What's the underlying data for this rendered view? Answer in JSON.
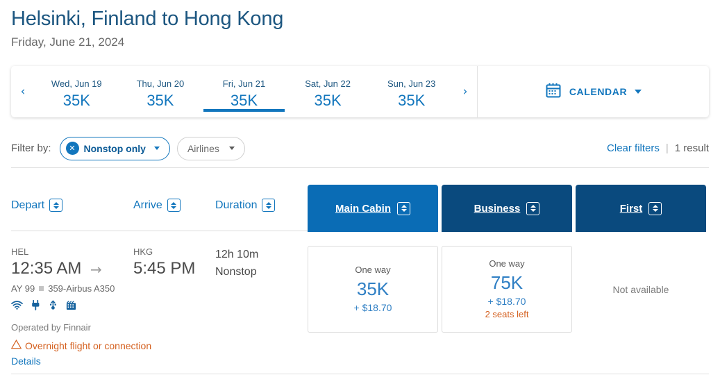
{
  "header": {
    "title": "Helsinki, Finland to Hong Kong",
    "subtitle": "Friday, June 21, 2024"
  },
  "date_strip": {
    "prev_icon": "chevron-left-icon",
    "next_icon": "chevron-right-icon",
    "prev_glyph": "‹",
    "next_glyph": "›",
    "tabs": [
      {
        "label": "Wed, Jun 19",
        "price": "35K",
        "active": false
      },
      {
        "label": "Thu, Jun 20",
        "price": "35K",
        "active": false
      },
      {
        "label": "Fri, Jun 21",
        "price": "35K",
        "active": true
      },
      {
        "label": "Sat, Jun 22",
        "price": "35K",
        "active": false
      },
      {
        "label": "Sun, Jun 23",
        "price": "35K",
        "active": false
      }
    ],
    "calendar": {
      "icon": "calendar-icon",
      "label": "CALENDAR"
    }
  },
  "filters": {
    "label": "Filter by:",
    "pills": [
      {
        "label": "Nonstop only",
        "active": true,
        "remove_glyph": "✕"
      },
      {
        "label": "Airlines",
        "active": false
      }
    ],
    "clear_filters": "Clear filters",
    "separator": "|",
    "result_count": "1 result"
  },
  "columns": {
    "depart": "Depart",
    "arrive": "Arrive",
    "duration": "Duration"
  },
  "cabins": [
    {
      "label": "Main Cabin",
      "active": true,
      "color": "#0a6cb5"
    },
    {
      "label": "Business",
      "active": false,
      "color": "#0a4a7e"
    },
    {
      "label": "First",
      "active": false,
      "color": "#0a4a7e"
    }
  ],
  "flight": {
    "depart_code": "HEL",
    "depart_time": "12:35 AM",
    "arrow_glyph": "→",
    "arrive_code": "HKG",
    "arrive_time": "5:45 PM",
    "duration": "12h 10m",
    "stops": "Nonstop",
    "flight_number": "AY 99",
    "aircraft": "359-Airbus A350",
    "amenities": [
      "wifi-icon",
      "power-outlet-icon",
      "usb-power-icon",
      "entertainment-icon"
    ],
    "operated_by": "Operated by Finnair",
    "warning_glyph": "⚠",
    "warning_text": "Overnight flight or connection",
    "details_label": "Details",
    "fares": [
      {
        "cabin": "Main Cabin",
        "available": true,
        "one_way_label": "One way",
        "miles": "35K",
        "fee": "+ $18.70",
        "seats_left": ""
      },
      {
        "cabin": "Business",
        "available": true,
        "one_way_label": "One way",
        "miles": "75K",
        "fee": "+ $18.70",
        "seats_left": "2 seats left"
      },
      {
        "cabin": "First",
        "available": false,
        "not_available_label": "Not available"
      }
    ]
  },
  "colors": {
    "brand_blue": "#1276bd",
    "dark_navy": "#0a4a7e",
    "active_tab_blue": "#0a6cb5",
    "title_blue": "#1c5680",
    "warning_orange": "#d4601f"
  }
}
